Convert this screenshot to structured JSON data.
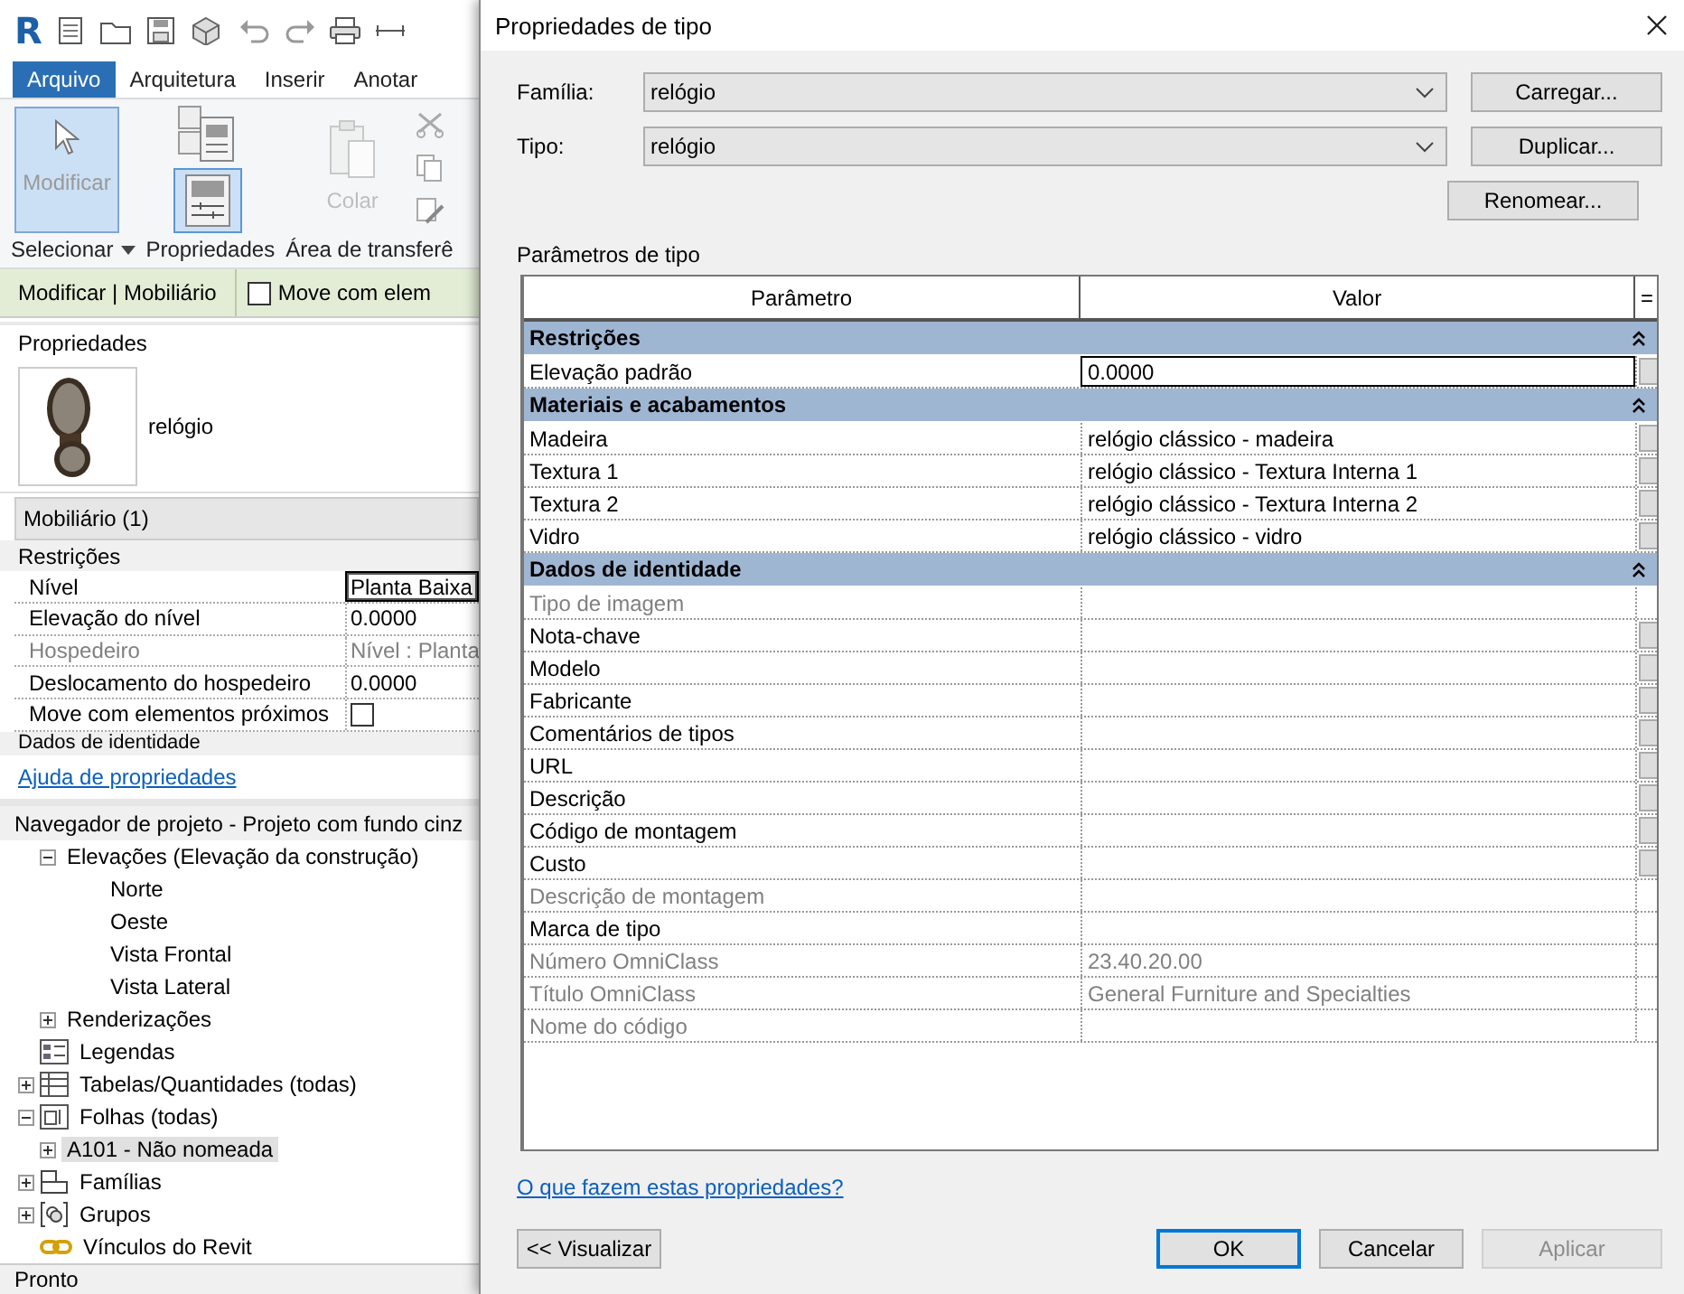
{
  "qat": {
    "logo": "R"
  },
  "ribbon_tabs": [
    {
      "label": "Arquivo",
      "kind": "file"
    },
    {
      "label": "Arquitetura",
      "kind": "tab"
    },
    {
      "label": "Inserir",
      "kind": "tab"
    },
    {
      "label": "Anotar",
      "kind": "tab"
    }
  ],
  "ribbon": {
    "modify_button": {
      "label": "Modificar",
      "selected": true
    },
    "properties_button": {
      "selected": true
    },
    "paste_button": {
      "label": "Colar",
      "disabled": true
    },
    "panels": [
      "Selecionar",
      "Propriedades",
      "Área de transferê"
    ]
  },
  "context_bar": {
    "title": "Modificar | Mobiliário",
    "option": {
      "label": "Move com elem",
      "checked": false
    }
  },
  "properties_palette": {
    "title": "Propriedades",
    "type_name": "relógio",
    "category": "Mobiliário (1)",
    "groups": [
      {
        "label": "Restrições",
        "rows": [
          {
            "name": "Nível",
            "value": "Planta Baixa",
            "kind": "text",
            "disabled": false,
            "selected": true
          },
          {
            "name": "Elevação do nível",
            "value": "0.0000",
            "kind": "text",
            "disabled": false,
            "selected": false
          },
          {
            "name": "Hospedeiro",
            "value": "Nível : Planta",
            "kind": "text",
            "disabled": true,
            "selected": false
          },
          {
            "name": "Deslocamento do hospedeiro",
            "value": "0.0000",
            "kind": "text",
            "disabled": false,
            "selected": false
          },
          {
            "name": "Move com elementos próximos",
            "kind": "checkbox",
            "checked": false,
            "disabled": false,
            "selected": false
          }
        ]
      }
    ],
    "next_group": "Dados de identidade",
    "help_link": "Ajuda de propriedades"
  },
  "project_browser": {
    "title": "Navegador de projeto - Projeto com fundo cinz",
    "partial_items": [
      {
        "label": "Elevações (Elevação da construção)",
        "expanded": true,
        "children": [
          {
            "label": "Norte"
          },
          {
            "label": "Oeste"
          },
          {
            "label": "Vista Frontal"
          },
          {
            "label": "Vista Lateral"
          }
        ]
      },
      {
        "label": "Renderizações",
        "expanded": false
      }
    ],
    "items": [
      {
        "label": "Legendas",
        "kind": "legends"
      },
      {
        "label": "Tabelas/Quantidades (todas)",
        "kind": "schedules",
        "expanded": false
      },
      {
        "label": "Folhas (todas)",
        "kind": "sheets",
        "expanded": true,
        "children": [
          {
            "label": "A101 - Não nomeada",
            "expanded": false,
            "selected": true
          }
        ]
      },
      {
        "label": "Famílias",
        "kind": "families",
        "expanded": false
      },
      {
        "label": "Grupos",
        "kind": "groups",
        "expanded": false
      },
      {
        "label": "Vínculos do Revit",
        "kind": "links"
      }
    ]
  },
  "status_bar": {
    "text": "Pronto"
  },
  "dialog": {
    "title": "Propriedades de tipo",
    "family": {
      "label": "Família:",
      "value": "relógio"
    },
    "type": {
      "label": "Tipo:",
      "value": "relógio"
    },
    "side_buttons": [
      "Carregar...",
      "Duplicar...",
      "Renomear..."
    ],
    "section_label": "Parâmetros de tipo",
    "columns": [
      "Parâmetro",
      "Valor",
      "="
    ],
    "groups": [
      {
        "label": "Restrições",
        "expanded": true,
        "rows": [
          {
            "param": "Elevação padrão",
            "value": "0.0000",
            "disabled": false,
            "selected": true,
            "has_button": true
          }
        ]
      },
      {
        "label": "Materiais e acabamentos",
        "expanded": true,
        "rows": [
          {
            "param": "Madeira",
            "value": "relógio clássico - madeira",
            "disabled": false,
            "selected": false,
            "has_button": true
          },
          {
            "param": "Textura 1",
            "value": "relógio clássico - Textura Interna 1",
            "disabled": false,
            "selected": false,
            "has_button": true
          },
          {
            "param": "Textura 2",
            "value": "relógio clássico - Textura Interna 2",
            "disabled": false,
            "selected": false,
            "has_button": true
          },
          {
            "param": "Vidro",
            "value": "relógio clássico - vidro",
            "disabled": false,
            "selected": false,
            "has_button": true
          }
        ]
      },
      {
        "label": "Dados de identidade",
        "expanded": true,
        "rows": [
          {
            "param": "Tipo de imagem",
            "disabled": true,
            "selected": false,
            "has_button": false
          },
          {
            "param": "Nota-chave",
            "disabled": false,
            "selected": false,
            "has_button": true
          },
          {
            "param": "Modelo",
            "disabled": false,
            "selected": false,
            "has_button": true
          },
          {
            "param": "Fabricante",
            "disabled": false,
            "selected": false,
            "has_button": true
          },
          {
            "param": "Comentários de tipos",
            "disabled": false,
            "selected": false,
            "has_button": true
          },
          {
            "param": "URL",
            "disabled": false,
            "selected": false,
            "has_button": true
          },
          {
            "param": "Descrição",
            "disabled": false,
            "selected": false,
            "has_button": true
          },
          {
            "param": "Código de montagem",
            "disabled": false,
            "selected": false,
            "has_button": true
          },
          {
            "param": "Custo",
            "disabled": false,
            "selected": false,
            "has_button": true
          },
          {
            "param": "Descrição de montagem",
            "disabled": true,
            "selected": false,
            "has_button": false
          },
          {
            "param": "Marca de tipo",
            "disabled": false,
            "selected": false,
            "has_button": false
          },
          {
            "param": "Número OmniClass",
            "value": "23.40.20.00",
            "disabled": true,
            "selected": false,
            "has_button": false
          },
          {
            "param": "Título OmniClass",
            "value": "General Furniture and Specialties",
            "disabled": true,
            "selected": false,
            "has_button": false
          },
          {
            "param": "Nome do código",
            "disabled": true,
            "selected": false,
            "has_button": false
          }
        ]
      }
    ],
    "help_link": "O que fazem estas propriedades?",
    "preview_button": "<< Visualizar",
    "buttons": [
      {
        "label": "OK",
        "kind": "default",
        "disabled": false
      },
      {
        "label": "Cancelar",
        "kind": "normal",
        "disabled": false
      },
      {
        "label": "Aplicar",
        "kind": "normal",
        "disabled": true
      }
    ]
  }
}
